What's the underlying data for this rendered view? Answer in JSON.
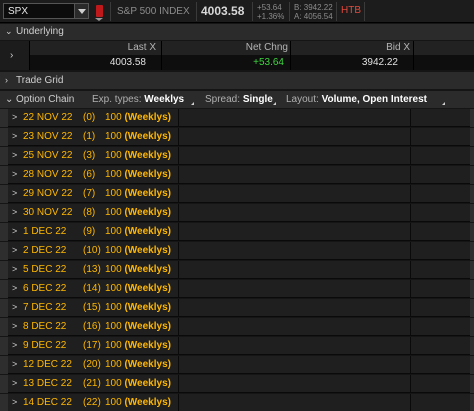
{
  "topbar": {
    "symbol": "SPX",
    "index_name": "S&P 500 INDEX",
    "last_price": "4003.58",
    "net_change": "+53.64",
    "pct_change": "+1.36%",
    "bid": "B: 3942.22",
    "ask": "A: 4056.54",
    "htb_label": "HTB"
  },
  "underlying": {
    "title": "Underlying",
    "columns": [
      "Last X",
      "Net Chng",
      "Bid X"
    ],
    "values": {
      "last": "4003.58",
      "net_change": "+53.64",
      "bid": "3942.22"
    }
  },
  "trade_grid": {
    "title": "Trade Grid"
  },
  "option_chain": {
    "title": "Option Chain",
    "exp_types_label": "Exp. types:",
    "exp_types_value": "Weeklys",
    "spread_label": "Spread:",
    "spread_value": "Single",
    "layout_label": "Layout:",
    "layout_value": "Volume, Open Interest"
  },
  "expirations": [
    {
      "date": "22 NOV 22",
      "days": "(0)",
      "mult": "100",
      "type": "(Weeklys)"
    },
    {
      "date": "23 NOV 22",
      "days": "(1)",
      "mult": "100",
      "type": "(Weeklys)"
    },
    {
      "date": "25 NOV 22",
      "days": "(3)",
      "mult": "100",
      "type": "(Weeklys)"
    },
    {
      "date": "28 NOV 22",
      "days": "(6)",
      "mult": "100",
      "type": "(Weeklys)"
    },
    {
      "date": "29 NOV 22",
      "days": "(7)",
      "mult": "100",
      "type": "(Weeklys)"
    },
    {
      "date": "30 NOV 22",
      "days": "(8)",
      "mult": "100",
      "type": "(Weeklys)"
    },
    {
      "date": "1 DEC 22",
      "days": "(9)",
      "mult": "100",
      "type": "(Weeklys)"
    },
    {
      "date": "2 DEC 22",
      "days": "(10)",
      "mult": "100",
      "type": "(Weeklys)"
    },
    {
      "date": "5 DEC 22",
      "days": "(13)",
      "mult": "100",
      "type": "(Weeklys)"
    },
    {
      "date": "6 DEC 22",
      "days": "(14)",
      "mult": "100",
      "type": "(Weeklys)"
    },
    {
      "date": "7 DEC 22",
      "days": "(15)",
      "mult": "100",
      "type": "(Weeklys)"
    },
    {
      "date": "8 DEC 22",
      "days": "(16)",
      "mult": "100",
      "type": "(Weeklys)"
    },
    {
      "date": "9 DEC 22",
      "days": "(17)",
      "mult": "100",
      "type": "(Weeklys)"
    },
    {
      "date": "12 DEC 22",
      "days": "(20)",
      "mult": "100",
      "type": "(Weeklys)"
    },
    {
      "date": "13 DEC 22",
      "days": "(21)",
      "mult": "100",
      "type": "(Weeklys)"
    },
    {
      "date": "14 DEC 22",
      "days": "(22)",
      "mult": "100",
      "type": "(Weeklys)"
    }
  ],
  "colors": {
    "accent_yellow": "#ffb800",
    "positive_green": "#3fd43f",
    "htb_red": "#e24a3b"
  }
}
